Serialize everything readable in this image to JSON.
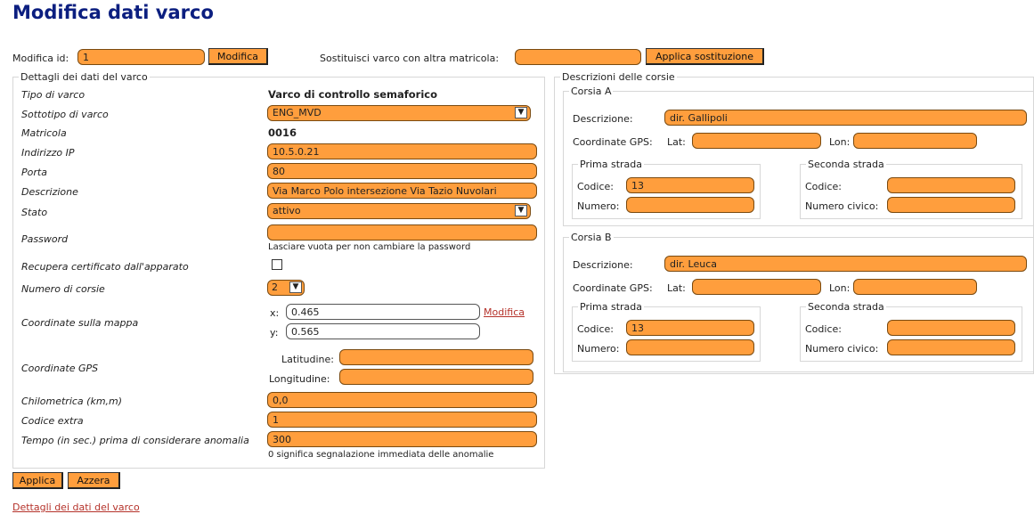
{
  "page": {
    "title": "Modifica dati varco"
  },
  "top": {
    "modify_id_label": "Modifica id:",
    "modify_id_value": "1",
    "modify_button": "Modifica",
    "replace_label": "Sostituisci varco con altra matricola:",
    "replace_value": "",
    "replace_button": "Applica sostituzione"
  },
  "details": {
    "legend": "Dettagli dei dati del varco",
    "tipo_label": "Tipo di varco",
    "tipo_value": "Varco di controllo semaforico",
    "sottotipo_label": "Sottotipo di varco",
    "sottotipo_value": "ENG_MVD",
    "matricola_label": "Matricola",
    "matricola_value": "0016",
    "ip_label": "Indirizzo IP",
    "ip_value": "10.5.0.21",
    "porta_label": "Porta",
    "porta_value": "80",
    "descrizione_label": "Descrizione",
    "descrizione_value": "Via Marco Polo intersezione Via Tazio Nuvolari",
    "stato_label": "Stato",
    "stato_value": "attivo",
    "password_label": "Password",
    "password_value": "",
    "password_hint": "Lasciare vuota per non cambiare la password",
    "recupera_label": "Recupera certificato dall'apparato",
    "corsie_label": "Numero di corsie",
    "corsie_value": "2",
    "mappa_label": "Coordinate sulla mappa",
    "x_label": "x:",
    "x_value": "0.465",
    "y_label": "y:",
    "y_value": "0.565",
    "mappa_link": "Modifica",
    "gps_label": "Coordinate GPS",
    "lat_label": "Latitudine:",
    "lat_value": "",
    "lon_label": "Longitudine:",
    "lon_value": "",
    "chilometrica_label": "Chilometrica (km,m)",
    "chilometrica_value": "0,0",
    "codice_extra_label": "Codice extra",
    "codice_extra_value": "1",
    "tempo_label": "Tempo (in sec.) prima di considerare anomalia",
    "tempo_value": "300",
    "tempo_hint": "0 significa segnalazione immediata delle anomalie"
  },
  "lanes": {
    "legend": "Descrizioni delle corsie",
    "corsia_a": {
      "legend": "Corsia A",
      "descrizione_label": "Descrizione:",
      "descrizione_value": "dir. Gallipoli",
      "gps_label": "Coordinate GPS:",
      "lat_label": "Lat:",
      "lat_value": "",
      "lon_label": "Lon:",
      "lon_value": "",
      "prima_legend": "Prima strada",
      "prima_codice_label": "Codice:",
      "prima_codice_value": "13",
      "prima_numero_label": "Numero:",
      "prima_numero_value": "",
      "seconda_legend": "Seconda strada",
      "seconda_codice_label": "Codice:",
      "seconda_codice_value": "",
      "seconda_civico_label": "Numero civico:",
      "seconda_civico_value": ""
    },
    "corsia_b": {
      "legend": "Corsia B",
      "descrizione_label": "Descrizione:",
      "descrizione_value": "dir. Leuca",
      "gps_label": "Coordinate GPS:",
      "lat_label": "Lat:",
      "lat_value": "",
      "lon_label": "Lon:",
      "lon_value": "",
      "prima_legend": "Prima strada",
      "prima_codice_label": "Codice:",
      "prima_codice_value": "13",
      "prima_numero_label": "Numero:",
      "prima_numero_value": "",
      "seconda_legend": "Seconda strada",
      "seconda_codice_label": "Codice:",
      "seconda_codice_value": "",
      "seconda_civico_label": "Numero civico:",
      "seconda_civico_value": ""
    }
  },
  "footer": {
    "apply_button": "Applica",
    "reset_button": "Azzera",
    "details_link": "Dettagli dei dati del varco"
  },
  "colors": {
    "accent": "#ff9e3d",
    "title": "#0c1f80",
    "link": "#b5322a"
  }
}
